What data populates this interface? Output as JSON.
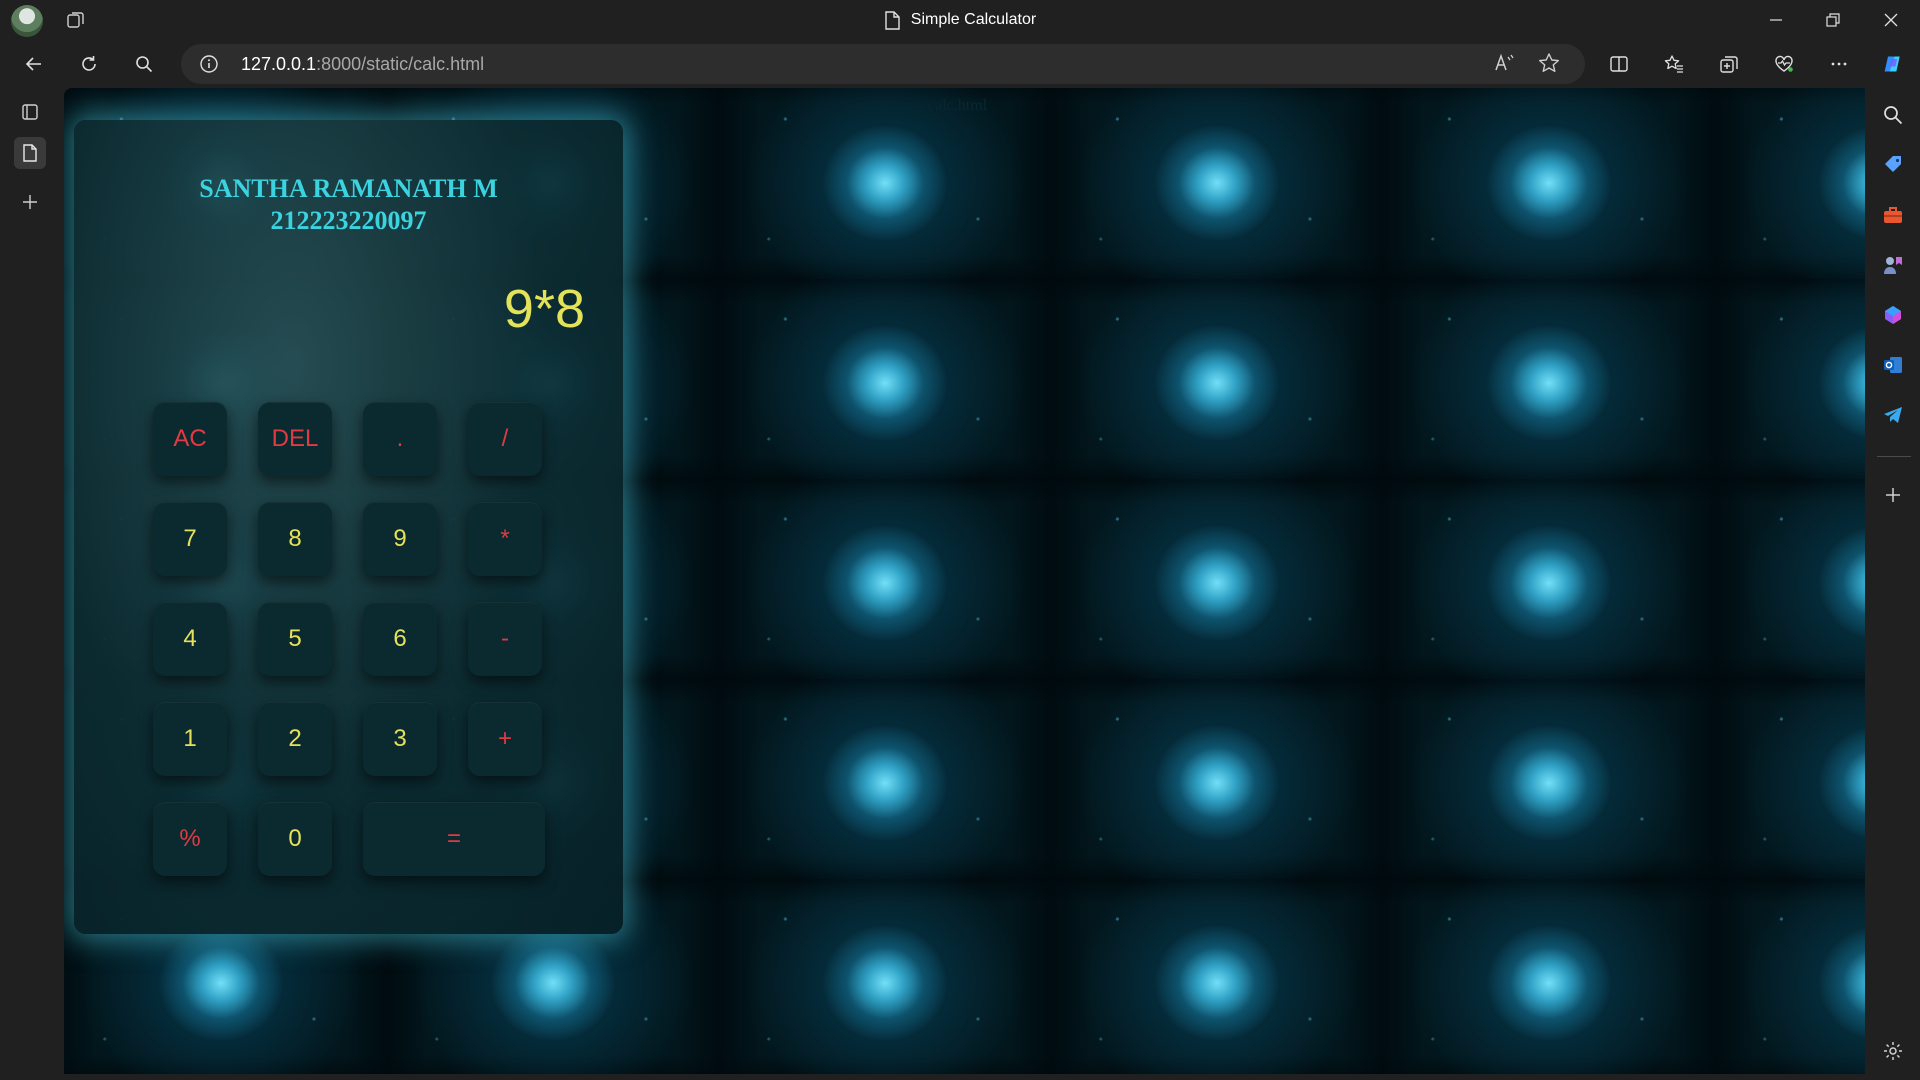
{
  "window": {
    "title": "Simple Calculator"
  },
  "addressbar": {
    "url_host": "127.0.0.1",
    "url_path": ":8000/static/calc.html"
  },
  "page": {
    "tag_text": "calc.html"
  },
  "calculator": {
    "name": "SANTHA RAMANATH M",
    "id_number": "212223220097",
    "display": "9*8",
    "keys": [
      {
        "label": "AC",
        "color": "red"
      },
      {
        "label": "DEL",
        "color": "red"
      },
      {
        "label": ".",
        "color": "red"
      },
      {
        "label": "/",
        "color": "red"
      },
      {
        "label": "7",
        "color": "yellow"
      },
      {
        "label": "8",
        "color": "yellow"
      },
      {
        "label": "9",
        "color": "yellow"
      },
      {
        "label": "*",
        "color": "red"
      },
      {
        "label": "4",
        "color": "yellow"
      },
      {
        "label": "5",
        "color": "yellow"
      },
      {
        "label": "6",
        "color": "yellow"
      },
      {
        "label": "-",
        "color": "red"
      },
      {
        "label": "1",
        "color": "yellow"
      },
      {
        "label": "2",
        "color": "yellow"
      },
      {
        "label": "3",
        "color": "yellow"
      },
      {
        "label": "+",
        "color": "red"
      },
      {
        "label": "%",
        "color": "red"
      },
      {
        "label": "0",
        "color": "yellow"
      },
      {
        "label": "=",
        "color": "red"
      }
    ]
  },
  "colors": {
    "accent_cyan": "#3cd3e0",
    "digit_yellow": "#e6e05a",
    "operator_red": "#e13a44"
  },
  "icons": {
    "titlebar": [
      "profile-avatar",
      "workspaces-icon",
      "page-icon",
      "minimize-icon",
      "restore-icon",
      "close-icon"
    ],
    "toolbar": [
      "back-icon",
      "refresh-icon",
      "search-icon",
      "site-info-icon",
      "read-aloud-icon",
      "favorite-star-icon",
      "split-screen-icon",
      "favorites-icon",
      "collections-icon",
      "browser-essentials-icon",
      "more-icon",
      "copilot-icon"
    ],
    "leftbar": [
      "tab-actions-icon",
      "vertical-tab-page-icon",
      "new-tab-icon"
    ],
    "rightbar": [
      "sidebar-search-icon",
      "shopping-icon",
      "tools-icon",
      "games-icon",
      "microsoft365-icon",
      "outlook-icon",
      "telegram-icon",
      "add-sidebar-app-icon",
      "settings-icon"
    ]
  }
}
